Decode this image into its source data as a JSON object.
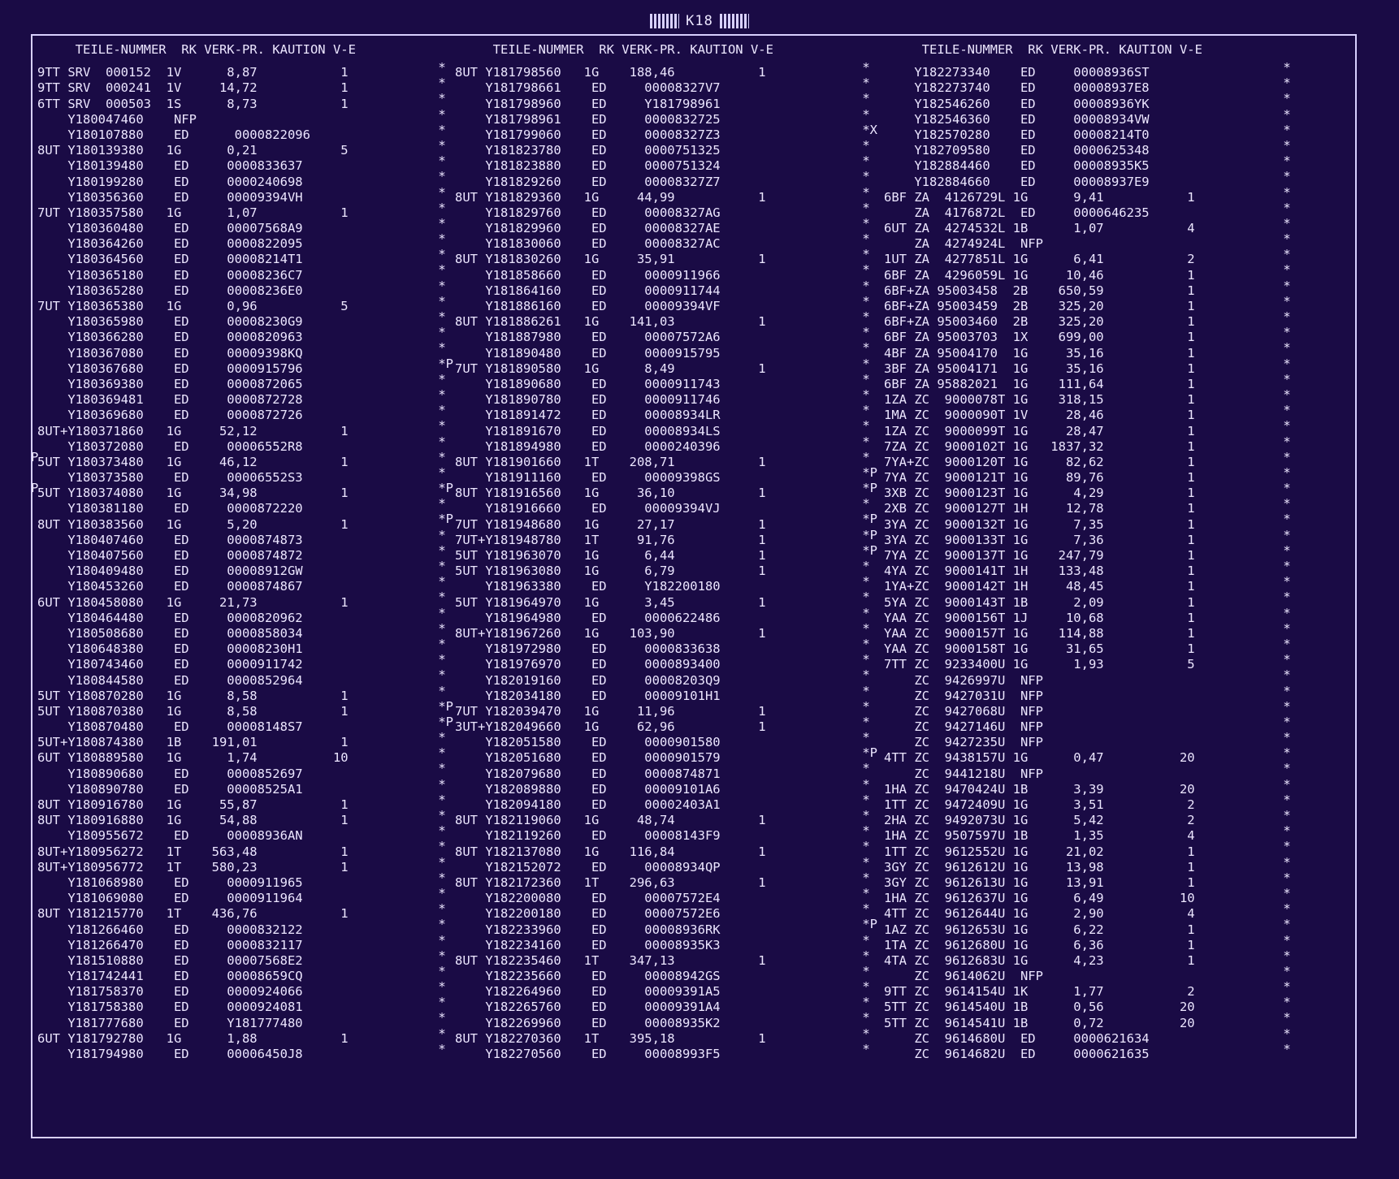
{
  "page_label": "K18",
  "header": "     TEILE-NUMMER  RK VERK-PR. KAUTION V-E",
  "columns": [
    {
      "rows": [
        "9TT SRV  000152  1V      8,87           1",
        "9TT SRV  000241  1V     14,72           1",
        "6TT SRV  000503  1S      8,73           1",
        "    Y180047460    NFP",
        "    Y180107880    ED      0000822096",
        "8UT Y180139380   1G      0,21           5",
        "    Y180139480    ED     0000833637",
        "    Y180199280    ED     0000240698",
        "    Y180356360    ED     00009394VH",
        "7UT Y180357580   1G      1,07           1",
        "    Y180360480    ED     00007568A9",
        "    Y180364260    ED     0000822095",
        "    Y180364560    ED     00008214T1",
        "    Y180365180    ED     00008236C7",
        "    Y180365280    ED     00008236E0",
        "7UT Y180365380   1G      0,96           5",
        "    Y180365980    ED     00008230G9",
        "    Y180366280    ED     0000820963",
        "    Y180367080    ED     00009398KQ",
        "    Y180367680    ED     0000915796",
        "    Y180369380    ED     0000872065",
        "    Y180369481    ED     0000872728",
        "    Y180369680    ED     0000872726",
        "8UT+Y180371860   1G     52,12           1",
        "    Y180372080    ED     00006552R8",
        "5UT Y180373480   1G     46,12           1",
        "    Y180373580    ED     00006552S3",
        "5UT Y180374080   1G     34,98           1",
        "    Y180381180    ED     0000872220",
        "8UT Y180383560   1G      5,20           1",
        "    Y180407460    ED     0000874873",
        "    Y180407560    ED     0000874872",
        "    Y180409480    ED     00008912GW",
        "    Y180453260    ED     0000874867",
        "6UT Y180458080   1G     21,73           1",
        "    Y180464480    ED     0000820962",
        "    Y180508680    ED     0000858034",
        "    Y180648380    ED     00008230H1",
        "    Y180743460    ED     0000911742",
        "    Y180844580    ED     0000852964",
        "5UT Y180870280   1G      8,58           1",
        "5UT Y180870380   1G      8,58           1",
        "    Y180870480    ED     00008148S7",
        "5UT+Y180874380   1B    191,01           1",
        "6UT Y180889580   1G      1,74          10",
        "    Y180890680    ED     0000852697",
        "    Y180890780    ED     00008525A1",
        "8UT Y180916780   1G     55,87           1",
        "8UT Y180916880   1G     54,88           1",
        "    Y180955672    ED     00008936AN",
        "8UT+Y180956272   1T    563,48           1",
        "8UT+Y180956772   1T    580,23           1",
        "    Y181068980    ED     0000911965",
        "    Y181069080    ED     0000911964",
        "8UT Y181215770   1T    436,76           1",
        "    Y181266460    ED     0000832122",
        "    Y181266470    ED     0000832117",
        "    Y181510880    ED     00007568E2",
        "    Y181742441    ED     00008659CQ",
        "    Y181758370    ED     0000924066",
        "    Y181758380    ED     0000924081",
        "    Y181777680    ED     Y181777480",
        "6UT Y181792780   1G      1,88           1",
        "    Y181794980    ED     00006450J8"
      ]
    },
    {
      "rows": [
        "8UT Y181798560   1G    188,46           1",
        "    Y181798661    ED     00008327V7",
        "    Y181798960    ED     Y181798961",
        "    Y181798961    ED     0000832725",
        "    Y181799060    ED     00008327Z3",
        "    Y181823780    ED     0000751325",
        "    Y181823880    ED     0000751324",
        "    Y181829260    ED     00008327Z7",
        "8UT Y181829360   1G     44,99           1",
        "    Y181829760    ED     00008327AG",
        "    Y181829960    ED     00008327AE",
        "    Y181830060    ED     00008327AC",
        "8UT Y181830260   1G     35,91           1",
        "    Y181858660    ED     0000911966",
        "    Y181864160    ED     0000911744",
        "    Y181886160    ED     00009394VF",
        "8UT Y181886261   1G    141,03           1",
        "    Y181887980    ED     00007572A6",
        "    Y181890480    ED     0000915795",
        "7UT Y181890580   1G      8,49           1",
        "    Y181890680    ED     0000911743",
        "    Y181890780    ED     0000911746",
        "    Y181891472    ED     00008934LR",
        "    Y181891670    ED     00008934LS",
        "    Y181894980    ED     0000240396",
        "8UT Y181901660   1T    208,71           1",
        "    Y181911160    ED     00009398GS",
        "8UT Y181916560   1G     36,10           1",
        "    Y181916660    ED     00009394VJ",
        "7UT Y181948680   1G     27,17           1",
        "7UT+Y181948780   1T     91,76           1",
        "5UT Y181963070   1G      6,44           1",
        "5UT Y181963080   1G      6,79           1",
        "    Y181963380    ED     Y182200180",
        "5UT Y181964970   1G      3,45           1",
        "    Y181964980    ED     0000622486",
        "8UT+Y181967260   1G    103,90           1",
        "    Y181972980    ED     0000833638",
        "    Y181976970    ED     0000893400",
        "    Y182019160    ED     00008203Q9",
        "    Y182034180    ED     00009101H1",
        "7UT Y182039470   1G     11,96           1",
        "3UT+Y182049660   1G     62,96           1",
        "    Y182051580    ED     0000901580",
        "    Y182051680    ED     0000901579",
        "    Y182079680    ED     0000874871",
        "    Y182089880    ED     00009101A6",
        "    Y182094180    ED     00002403A1",
        "8UT Y182119060   1G     48,74           1",
        "    Y182119260    ED     00008143F9",
        "8UT Y182137080   1G    116,84           1",
        "    Y182152072    ED     00008934QP",
        "8UT Y182172360   1T    296,63           1",
        "    Y182200080    ED     00007572E4",
        "    Y182200180    ED     00007572E6",
        "    Y182233960    ED     00008936RK",
        "    Y182234160    ED     00008935K3",
        "8UT Y182235460   1T    347,13           1",
        "    Y182235660    ED     00008942GS",
        "    Y182264960    ED     00009391A5",
        "    Y182265760    ED     00009391A4",
        "    Y182269960    ED     00008935K2",
        "8UT Y182270360   1T    395,18           1",
        "    Y182270560    ED     00008993F5"
      ]
    },
    {
      "rows": [
        "    Y182273340    ED     00008936ST",
        "    Y182273740    ED     00008937E8",
        "    Y182546260    ED     00008936YK",
        "    Y182546360    ED     00008934VW",
        "    Y182570280    ED     00008214T0",
        "    Y182709580    ED     0000625348",
        "    Y182884460    ED     00008935K5",
        "    Y182884660    ED     00008937E9",
        "6BF ZA  4126729L 1G      9,41           1",
        "    ZA  4176872L  ED     0000646235",
        "6UT ZA  4274532L 1B      1,07           4",
        "    ZA  4274924L  NFP",
        "1UT ZA  4277851L 1G      6,41           2",
        "6BF ZA  4296059L 1G     10,46           1",
        "6BF+ZA 95003458  2B    650,59           1",
        "6BF+ZA 95003459  2B    325,20           1",
        "6BF+ZA 95003460  2B    325,20           1",
        "6BF ZA 95003703  1X    699,00           1",
        "4BF ZA 95004170  1G     35,16           1",
        "3BF ZA 95004171  1G     35,16           1",
        "6BF ZA 95882021  1G    111,64           1",
        "1ZA ZC  9000078T 1G    318,15           1",
        "1MA ZC  9000090T 1V     28,46           1",
        "1ZA ZC  9000099T 1G     28,47           1",
        "7ZA ZC  9000102T 1G   1837,32           1",
        "7YA+ZC  9000120T 1G     82,62           1",
        "7YA ZC  9000121T 1G     89,76           1",
        "3XB ZC  9000123T 1G      4,29           1",
        "2XB ZC  9000127T 1H     12,78           1",
        "3YA ZC  9000132T 1G      7,35           1",
        "3YA ZC  9000133T 1G      7,36           1",
        "7YA ZC  9000137T 1G    247,79           1",
        "4YA ZC  9000141T 1H    133,48           1",
        "1YA+ZC  9000142T 1H     48,45           1",
        "5YA ZC  9000143T 1B      2,09           1",
        "YAA ZC  9000156T 1J     10,68           1",
        "YAA ZC  9000157T 1G    114,88           1",
        "YAA ZC  9000158T 1G     31,65           1",
        "7TT ZC  9233400U 1G      1,93           5",
        "    ZC  9426997U  NFP",
        "    ZC  9427031U  NFP",
        "    ZC  9427068U  NFP",
        "    ZC  9427146U  NFP",
        "    ZC  9427235U  NFP",
        "4TT ZC  9438157U 1G      0,47          20",
        "    ZC  9441218U  NFP",
        "1HA ZC  9470424U 1B      3,39          20",
        "1TT ZC  9472409U 1G      3,51           2",
        "2HA ZC  9492073U 1G      5,42           2",
        "1HA ZC  9507597U 1B      1,35           4",
        "1TT ZC  9612552U 1G     21,02           1",
        "3GY ZC  9612612U 1G     13,98           1",
        "3GY ZC  9612613U 1G     13,91           1",
        "1HA ZC  9612637U 1G      6,49          10",
        "4TT ZC  9612644U 1G      2,90           4",
        "1AZ ZC  9612653U 1G      6,22           1",
        "1TA ZC  9612680U 1G      6,36           1",
        "4TA ZC  9612683U 1G      4,23           1",
        "    ZC  9614062U  NFP",
        "9TT ZC  9614154U 1K      1,77           2",
        "5TT ZC  9614540U 1B      0,56          20",
        "5TT ZC  9614541U 1B      0,72          20",
        "    ZC  9614680U  ED     0000621634",
        "    ZC  9614682U  ED     0000621635"
      ]
    }
  ],
  "separators": [
    {
      "marks": [
        " *",
        " *",
        " *",
        " *",
        " *",
        " *",
        " *",
        " *",
        " *",
        " *",
        " *",
        " *",
        " *",
        " *",
        " *",
        " *",
        " *",
        " *",
        " *",
        " *P",
        " *",
        " *",
        " *",
        " *",
        " *",
        " *",
        " *",
        " *P",
        " *",
        " *P",
        " *",
        " *",
        " *",
        " *",
        " *",
        " *",
        " *",
        " *",
        " *",
        " *",
        " *",
        " *P",
        " *P",
        " *",
        " *",
        " *",
        " *",
        " *",
        " *",
        " *",
        " *",
        " *",
        " *",
        " *",
        " *",
        " *",
        " *",
        " *",
        " *",
        " *",
        " *",
        " *",
        " *",
        " *"
      ]
    },
    {
      "marks": [
        " *",
        " *",
        " *",
        " *",
        " *X",
        " *",
        " *",
        " *",
        " *",
        " *",
        " *",
        " *",
        " *",
        " *",
        " *",
        " *",
        " *",
        " *",
        " *",
        " *",
        " *",
        " *",
        " *",
        " *",
        " *",
        " *",
        " *P",
        " *P",
        " *",
        " *P",
        " *P",
        " *P",
        " *",
        " *",
        " *",
        " *",
        " *",
        " *",
        " *",
        " *",
        " *",
        " *",
        " *",
        " *",
        " *P",
        " *",
        " *",
        " *",
        " *",
        " *",
        " *",
        " *",
        " *",
        " *",
        " *",
        " *P",
        " *",
        " *",
        " *",
        " *",
        " *",
        " *",
        " *",
        " *"
      ]
    },
    {
      "marks": [
        " *",
        " *",
        " *",
        " *",
        " *",
        " *",
        " *",
        " *",
        " *",
        " *",
        " *",
        " *",
        " *",
        " *",
        " *",
        " *",
        " *",
        " *",
        " *",
        " *",
        " *",
        " *",
        " *",
        " *",
        " *",
        " *",
        " *",
        " *",
        " *",
        " *",
        " *",
        " *",
        " *",
        " *",
        " *",
        " *",
        " *",
        " *",
        " *",
        " *",
        " *",
        " *",
        " *",
        " *",
        " *",
        " *",
        " *",
        " *",
        " *",
        " *",
        " *",
        " *",
        " *",
        " *",
        " *",
        " *",
        " *",
        " *",
        " *",
        " *",
        " *",
        " *",
        " *",
        " *"
      ]
    }
  ],
  "left_margin_marks": [
    {
      "row": 25,
      "text": "P"
    },
    {
      "row": 27,
      "text": "P"
    }
  ]
}
